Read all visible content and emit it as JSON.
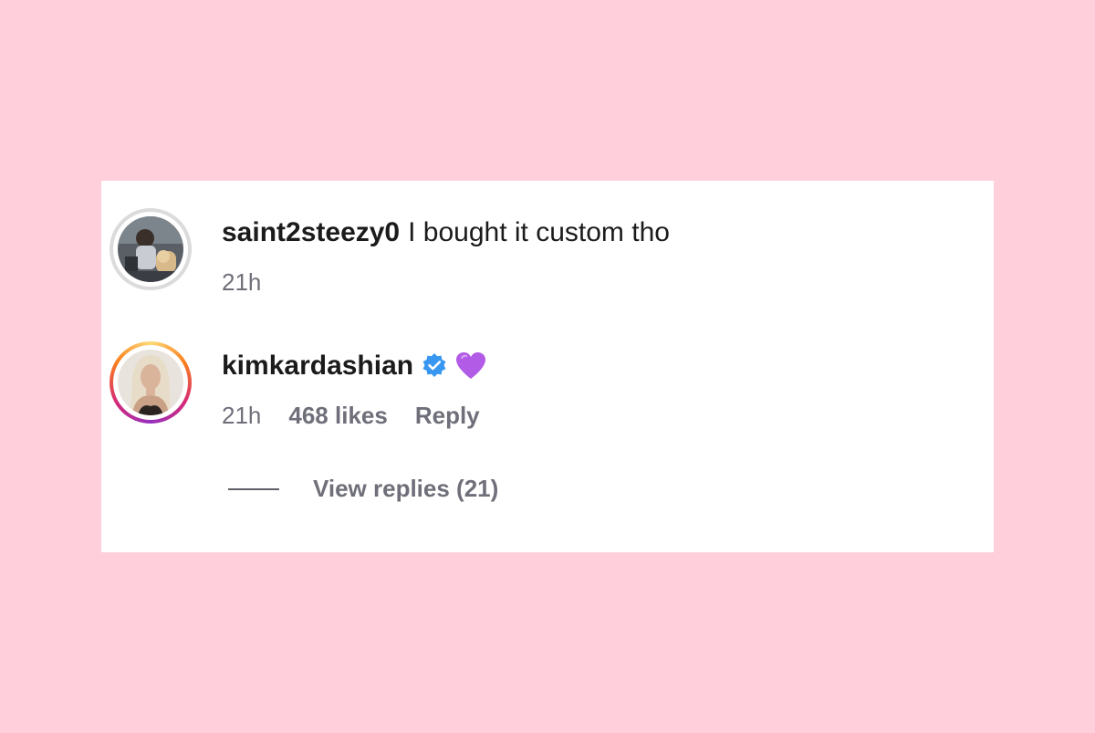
{
  "comments": [
    {
      "username": "saint2steezy0",
      "text": "I bought it custom tho",
      "time": "21h",
      "verified": false,
      "avatar_icon": "profile-photo"
    },
    {
      "username": "kimkardashian",
      "text": "💜",
      "time": "21h",
      "likes": "468 likes",
      "reply_label": "Reply",
      "verified": true,
      "avatar_icon": "profile-photo-story-ring"
    }
  ],
  "view_replies": "View replies (21)",
  "colors": {
    "background": "#ffd0dc",
    "card": "#ffffff",
    "verified_blue": "#3897f0",
    "meta_grey": "#6f6f7a",
    "emoji_purple": "#b25be6"
  }
}
